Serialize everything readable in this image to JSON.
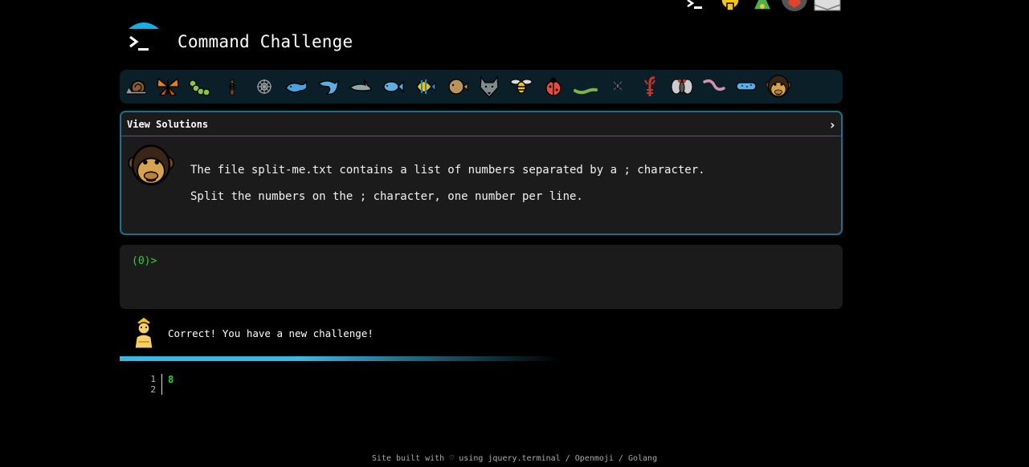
{
  "header": {
    "title": "Command Challenge"
  },
  "levels": [
    {
      "icon": "snail-icon"
    },
    {
      "icon": "butterfly-icon"
    },
    {
      "icon": "caterpillar-icon"
    },
    {
      "icon": "ant-icon"
    },
    {
      "icon": "spider-web-icon"
    },
    {
      "icon": "whale-icon"
    },
    {
      "icon": "dolphin-icon"
    },
    {
      "icon": "shark-icon"
    },
    {
      "icon": "fish-icon"
    },
    {
      "icon": "tropical-fish-icon"
    },
    {
      "icon": "blowfish-icon"
    },
    {
      "icon": "wolf-icon"
    },
    {
      "icon": "bee-icon"
    },
    {
      "icon": "ladybug-icon"
    },
    {
      "icon": "worm-icon"
    },
    {
      "icon": "spider-icon"
    },
    {
      "icon": "scorpion-icon"
    },
    {
      "icon": "fly-icon"
    },
    {
      "icon": "earthworm-icon"
    },
    {
      "icon": "microbe-icon"
    },
    {
      "icon": "chimpanzee-icon"
    }
  ],
  "challenge": {
    "header_label": "View Solutions",
    "lines": [
      "The file split-me.txt contains a list of numbers separated by a ; character.",
      "Split the numbers on the ; character, one number per line."
    ]
  },
  "terminal": {
    "prompt": "(0)>"
  },
  "feedback": {
    "message": "Correct! You have a new challenge!",
    "progress": 1.0
  },
  "output": {
    "line_numbers": [
      "1",
      "2"
    ],
    "value": "8"
  },
  "footer": {
    "text": "Site built with ♡ using jquery.terminal / Openmoji / Golang"
  },
  "colors": {
    "accent": "#1d6f8a",
    "progress": "#3bb8e0",
    "prompt": "#2bd62b"
  }
}
